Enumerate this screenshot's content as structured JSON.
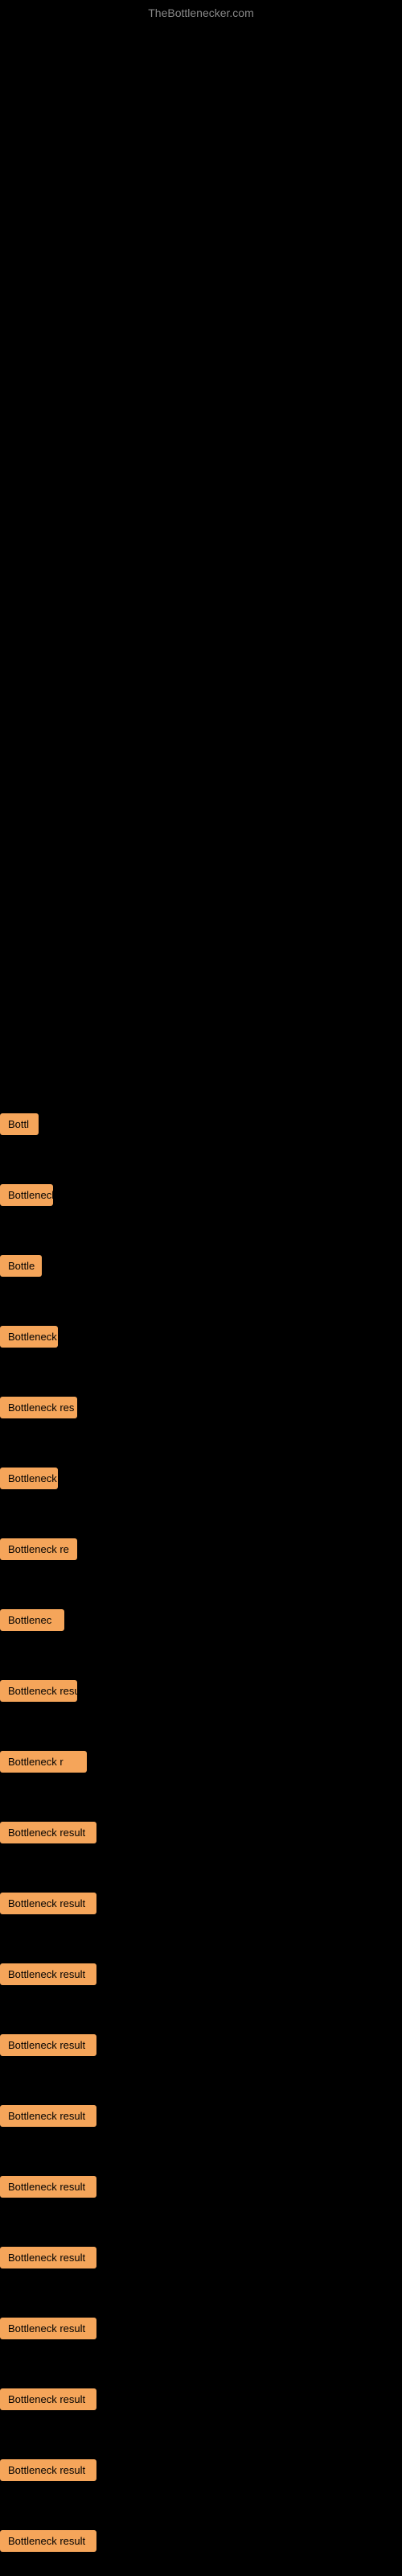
{
  "header": {
    "site_title": "TheBottlenecker.com"
  },
  "items": [
    {
      "id": 1,
      "label": "Bottl",
      "class": "item-1"
    },
    {
      "id": 2,
      "label": "Bottleneck",
      "class": "item-2"
    },
    {
      "id": 3,
      "label": "Bottle",
      "class": "item-3"
    },
    {
      "id": 4,
      "label": "Bottleneck",
      "class": "item-4"
    },
    {
      "id": 5,
      "label": "Bottleneck res",
      "class": "item-5"
    },
    {
      "id": 6,
      "label": "Bottleneck",
      "class": "item-6"
    },
    {
      "id": 7,
      "label": "Bottleneck re",
      "class": "item-7"
    },
    {
      "id": 8,
      "label": "Bottlenec",
      "class": "item-8"
    },
    {
      "id": 9,
      "label": "Bottleneck resu",
      "class": "item-9"
    },
    {
      "id": 10,
      "label": "Bottleneck r",
      "class": "item-10"
    },
    {
      "id": 11,
      "label": "Bottleneck result",
      "class": "item-11"
    },
    {
      "id": 12,
      "label": "Bottleneck result",
      "class": "item-12"
    },
    {
      "id": 13,
      "label": "Bottleneck result",
      "class": "item-13"
    },
    {
      "id": 14,
      "label": "Bottleneck result",
      "class": "item-14"
    },
    {
      "id": 15,
      "label": "Bottleneck result",
      "class": "item-15"
    },
    {
      "id": 16,
      "label": "Bottleneck result",
      "class": "item-16"
    },
    {
      "id": 17,
      "label": "Bottleneck result",
      "class": "item-17"
    },
    {
      "id": 18,
      "label": "Bottleneck result",
      "class": "item-18"
    },
    {
      "id": 19,
      "label": "Bottleneck result",
      "class": "item-19"
    },
    {
      "id": 20,
      "label": "Bottleneck result",
      "class": "item-20"
    },
    {
      "id": 21,
      "label": "Bottleneck result",
      "class": "item-21"
    }
  ]
}
